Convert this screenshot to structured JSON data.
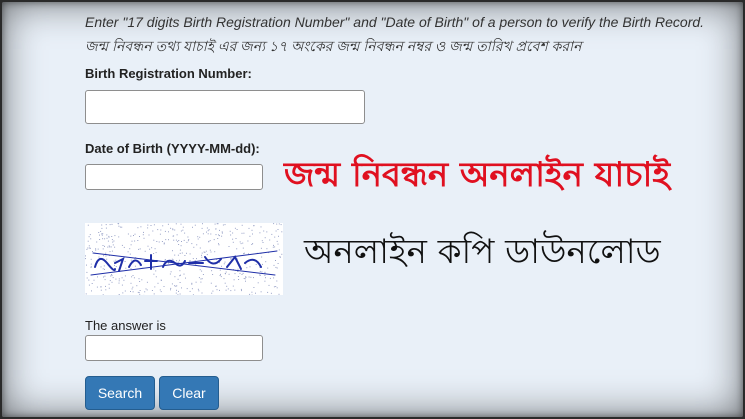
{
  "instructions": {
    "english": "Enter \"17 digits Birth Registration Number\" and \"Date of Birth\" of a person to verify the Birth Record.",
    "bangla": "জন্ম নিবন্ধন তথ্য যাচাই এর জন্য ১৭ অংকের জন্ম নিবন্ধন নম্বর ও জন্ম তারিখ প্রবেশ করান"
  },
  "form": {
    "birth_reg_label": "Birth Registration Number:",
    "birth_reg_value": "",
    "dob_label": "Date of Birth (YYYY-MM-dd):",
    "dob_value": "",
    "answer_label": "The answer is",
    "answer_value": ""
  },
  "overlay": {
    "red_title": "জন্ম নিবন্ধন অনলাইন যাচাই",
    "black_title": "অনলাইন কপি ডাউনলোড"
  },
  "buttons": {
    "search": "Search",
    "clear": "Clear"
  },
  "colors": {
    "background": "#e9f0f8",
    "button": "#3478b5",
    "red_text": "#e01020",
    "captcha_ink": "#1f2fa8"
  }
}
